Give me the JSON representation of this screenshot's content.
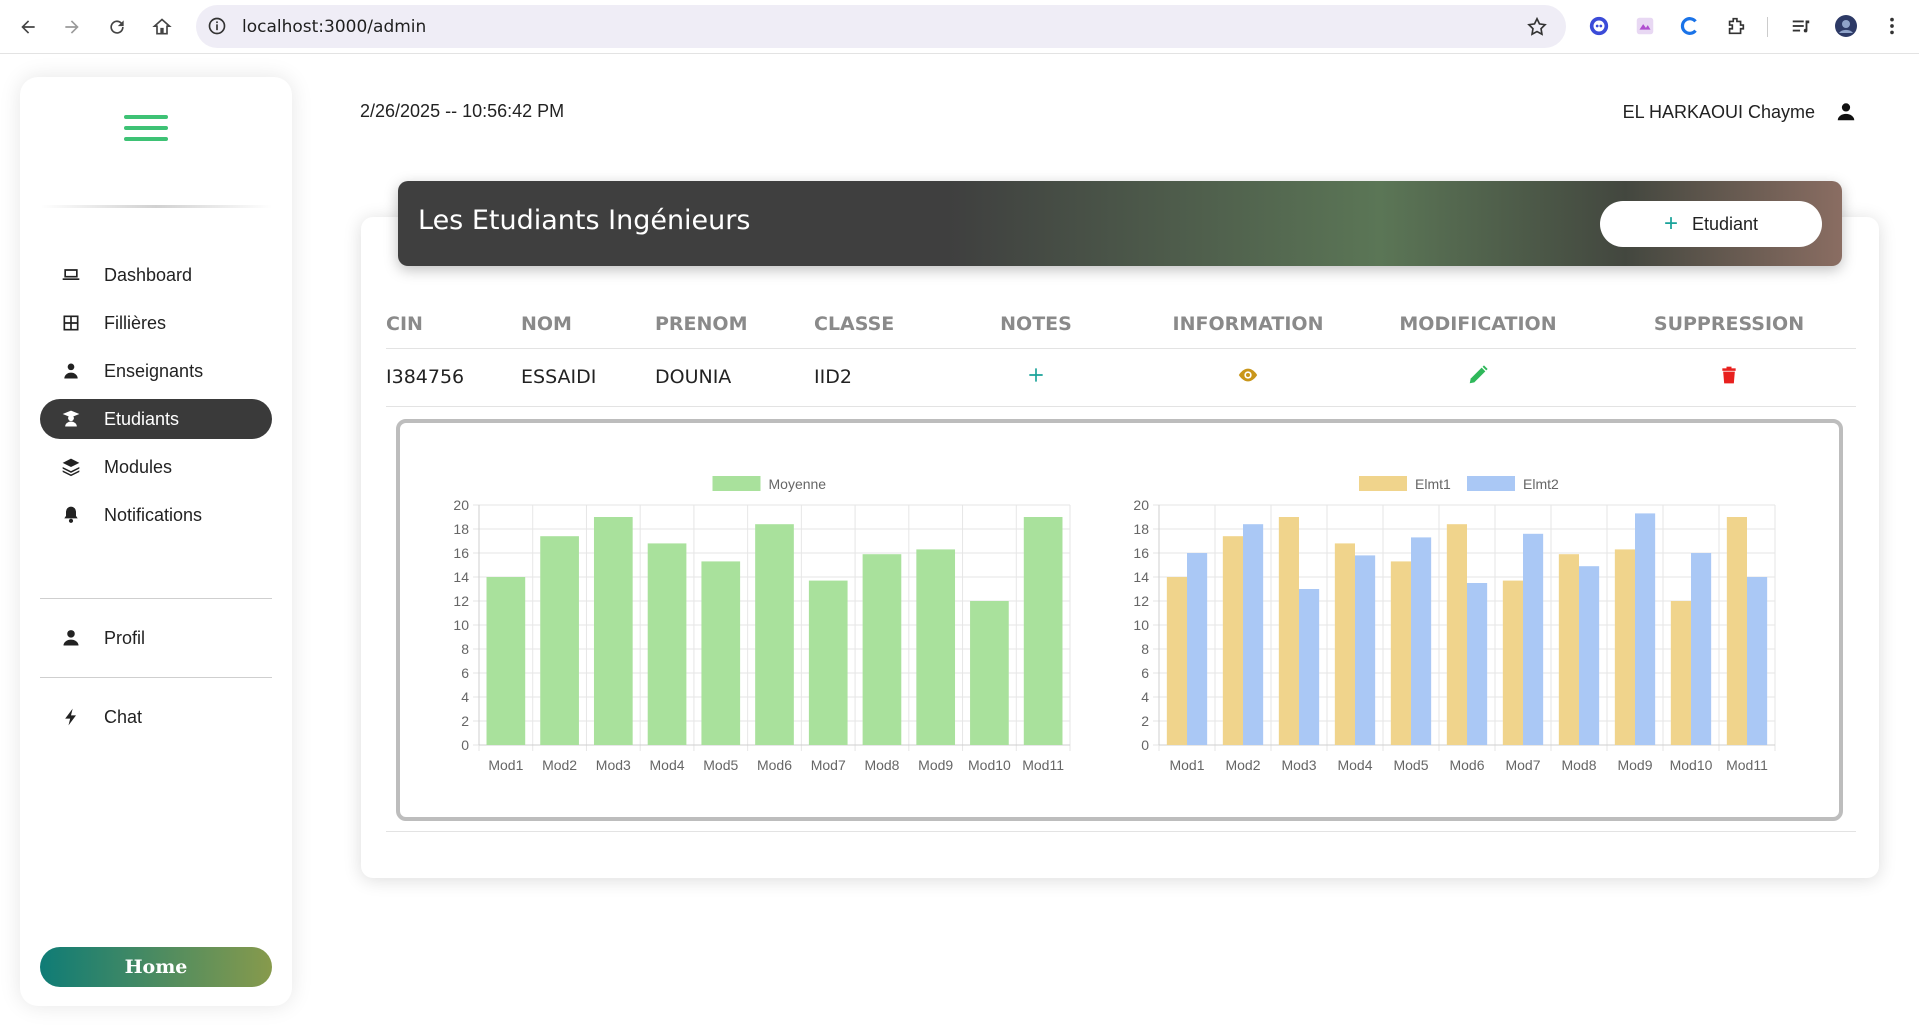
{
  "browser": {
    "url": "localhost:3000/admin"
  },
  "sidebar": {
    "items": [
      {
        "label": "Dashboard",
        "icon": "laptop-icon"
      },
      {
        "label": "Fillières",
        "icon": "table-icon"
      },
      {
        "label": "Enseignants",
        "icon": "teacher-icon"
      },
      {
        "label": "Etudiants",
        "icon": "student-icon",
        "active": true
      },
      {
        "label": "Modules",
        "icon": "layers-icon"
      },
      {
        "label": "Notifications",
        "icon": "bell-icon"
      }
    ],
    "secondary": [
      {
        "label": "Profil",
        "icon": "user-icon"
      },
      {
        "label": "Chat",
        "icon": "bolt-icon"
      }
    ],
    "home_label": "Home"
  },
  "topbar": {
    "datetime": "2/26/2025 -- 10:56:42 PM",
    "user_name": "EL HARKAOUI Chayme"
  },
  "page": {
    "title": "Les Etudiants Ingénieurs",
    "add_label": "Etudiant"
  },
  "table": {
    "headers": [
      "CIN",
      "NOM",
      "PRENOM",
      "CLASSE",
      "NOTES",
      "INFORMATION",
      "MODIFICATION",
      "SUPPRESSION"
    ],
    "rows": [
      {
        "cin": "I384756",
        "nom": "ESSAIDI",
        "prenom": "DOUNIA",
        "classe": "IID2"
      }
    ]
  },
  "colors": {
    "notes_icon": "#1aa39a",
    "info_icon": "#c9961a",
    "edit_icon": "#2fb85a",
    "delete_icon": "#e8201e",
    "moyenne_bar": "#a9e19c",
    "elmt1_bar": "#f0d48c",
    "elmt2_bar": "#aac8f5"
  },
  "chart_data": [
    {
      "type": "bar",
      "categories": [
        "Mod1",
        "Mod2",
        "Mod3",
        "Mod4",
        "Mod5",
        "Mod6",
        "Mod7",
        "Mod8",
        "Mod9",
        "Mod10",
        "Mod11"
      ],
      "series": [
        {
          "name": "Moyenne",
          "values": [
            14,
            17.4,
            19,
            16.8,
            15.3,
            18.4,
            13.7,
            15.9,
            16.3,
            12,
            19
          ]
        }
      ],
      "yticks": [
        "0",
        "2",
        "4",
        "6",
        "8",
        "10",
        "12",
        "14",
        "16",
        "18",
        "20"
      ],
      "ylim": [
        0,
        20
      ],
      "legend": "top"
    },
    {
      "type": "bar",
      "categories": [
        "Mod1",
        "Mod2",
        "Mod3",
        "Mod4",
        "Mod5",
        "Mod6",
        "Mod7",
        "Mod8",
        "Mod9",
        "Mod10",
        "Mod11"
      ],
      "series": [
        {
          "name": "Elmt1",
          "values": [
            14,
            17.4,
            19,
            16.8,
            15.3,
            18.4,
            13.7,
            15.9,
            16.3,
            12,
            19
          ]
        },
        {
          "name": "Elmt2",
          "values": [
            16,
            18.4,
            13,
            15.8,
            17.3,
            13.5,
            17.6,
            14.9,
            19.3,
            16,
            14
          ]
        }
      ],
      "yticks": [
        "0",
        "2",
        "4",
        "6",
        "8",
        "10",
        "12",
        "14",
        "16",
        "18",
        "20"
      ],
      "ylim": [
        0,
        20
      ],
      "legend": "top"
    }
  ]
}
